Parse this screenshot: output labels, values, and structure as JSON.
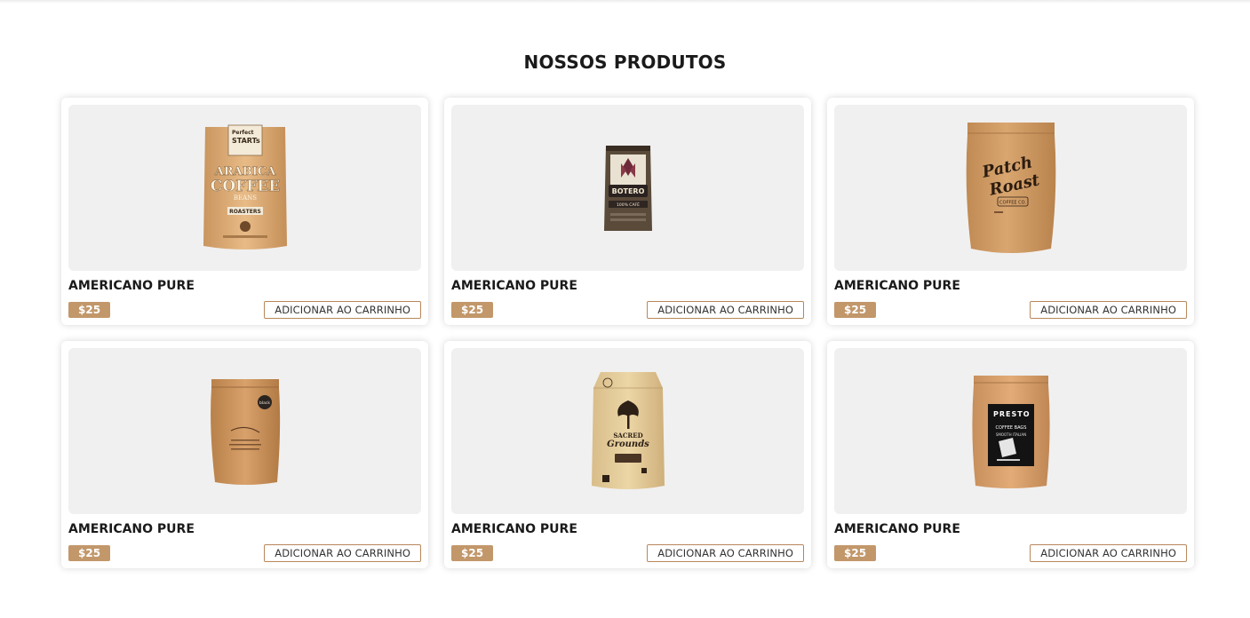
{
  "section": {
    "title": "NOSSOS PRODUTOS"
  },
  "products": [
    {
      "name": "AMERICANO PURE",
      "price": "$25",
      "button_label": "ADICIONAR AO CARRINHO",
      "image_icon": "coffee-bag-arabica-icon",
      "bag_text": [
        "Perfect",
        "STARTs",
        "ARABICA",
        "COFFEE",
        "BEANS",
        "ROASTERS"
      ]
    },
    {
      "name": "AMERICANO PURE",
      "price": "$25",
      "button_label": "ADICIONAR AO CARRINHO",
      "image_icon": "coffee-bag-botero-icon",
      "bag_text": [
        "BOTERO",
        "100% CAFÉ"
      ]
    },
    {
      "name": "AMERICANO PURE",
      "price": "$25",
      "button_label": "ADICIONAR AO CARRINHO",
      "image_icon": "coffee-bag-patch-roast-icon",
      "bag_text": [
        "Patch",
        "Roast",
        "COFFEE CO."
      ]
    },
    {
      "name": "AMERICANO PURE",
      "price": "$25",
      "button_label": "ADICIONAR AO CARRINHO",
      "image_icon": "coffee-bag-kraft-icon",
      "bag_text": [
        "black"
      ]
    },
    {
      "name": "AMERICANO PURE",
      "price": "$25",
      "button_label": "ADICIONAR AO CARRINHO",
      "image_icon": "coffee-bag-sacred-grounds-icon",
      "bag_text": [
        "SACRED",
        "Grounds"
      ]
    },
    {
      "name": "AMERICANO PURE",
      "price": "$25",
      "button_label": "ADICIONAR AO CARRINHO",
      "image_icon": "coffee-bag-presto-icon",
      "bag_text": [
        "PRESTO",
        "COFFEE BAGS",
        "SMOOTH ITALIAN"
      ]
    }
  ],
  "colors": {
    "price_badge": "#c2976a",
    "button_border": "#b8875a",
    "image_bg": "#f0f0f0",
    "kraft": "#d9a670"
  }
}
